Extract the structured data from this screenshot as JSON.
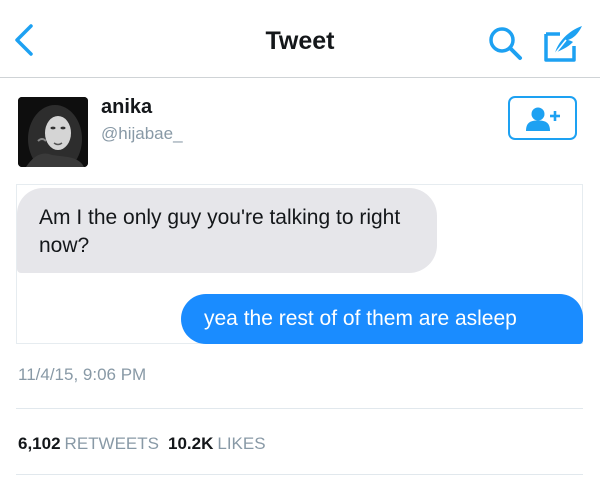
{
  "nav": {
    "title": "Tweet",
    "back_icon": "chevron-left-icon",
    "search_icon": "search-icon",
    "compose_icon": "compose-icon"
  },
  "author": {
    "display_name": "anika",
    "username": "@hijabae_",
    "follow_icon": "add-user-icon"
  },
  "messages": [
    {
      "direction": "incoming",
      "text": "Am I the only guy you're talking to right now?"
    },
    {
      "direction": "outgoing",
      "text": "yea the rest of of them are asleep"
    }
  ],
  "meta": {
    "timestamp": "11/4/15, 9:06 PM"
  },
  "stats": {
    "retweets_count": "6,102",
    "retweets_label": "RETWEETS",
    "likes_count": "10.2K",
    "likes_label": "LIKES"
  },
  "colors": {
    "accent": "#1da1f2",
    "outgoing_bubble": "#1a8cff",
    "incoming_bubble": "#e6e6ea",
    "muted_text": "#8899a6"
  }
}
